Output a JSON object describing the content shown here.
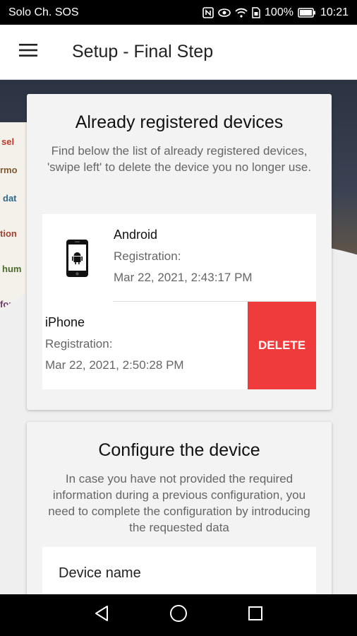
{
  "status_bar": {
    "carrier": "Solo Ch. SOS",
    "battery": "100%",
    "time": "10:21"
  },
  "app_bar": {
    "title": "Setup - Final Step"
  },
  "registered_card": {
    "title": "Already registered devices",
    "description": "Find below the list of already registered devices, 'swipe left' to delete the device you no longer use.",
    "devices": [
      {
        "name": "Android",
        "reg_label": "Registration:",
        "reg_date": "Mar 22, 2021, 2:43:17 PM",
        "icon": "android-phone-icon"
      },
      {
        "name": "iPhone",
        "reg_label": "Registration:",
        "reg_date": "Mar 22, 2021, 2:50:28 PM",
        "delete_label": "DELETE"
      }
    ]
  },
  "configure_card": {
    "title": "Configure the device",
    "description": "In case you have not provided the required information during a previous configuration, you need to complete the configuration by introducing the requested data",
    "field_label": "Device name"
  },
  "colors": {
    "delete": "#ef3b3b",
    "card_bg": "#f3f3f3"
  }
}
